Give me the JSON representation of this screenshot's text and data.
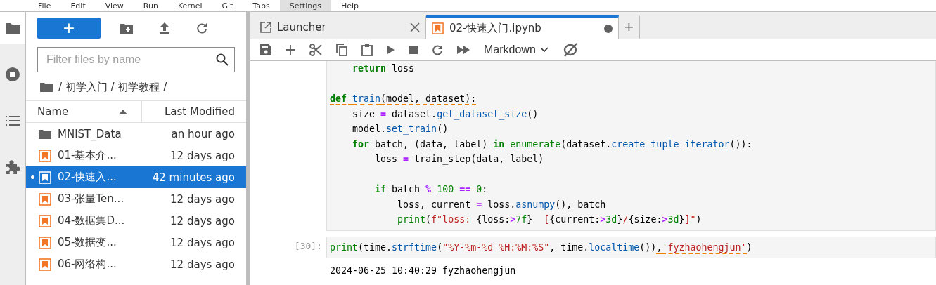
{
  "menu": [
    {
      "label": "File",
      "active": false
    },
    {
      "label": "Edit",
      "active": false
    },
    {
      "label": "View",
      "active": false
    },
    {
      "label": "Run",
      "active": false
    },
    {
      "label": "Kernel",
      "active": false
    },
    {
      "label": "Git",
      "active": false
    },
    {
      "label": "Tabs",
      "active": false
    },
    {
      "label": "Settings",
      "active": true
    },
    {
      "label": "Help",
      "active": false
    }
  ],
  "activity_bar": [
    {
      "kind": "folder",
      "selected": true
    },
    {
      "kind": "running",
      "selected": false
    },
    {
      "kind": "toc",
      "selected": false
    },
    {
      "kind": "extensions",
      "selected": false
    }
  ],
  "file_browser": {
    "new_button": "+",
    "filter": {
      "placeholder": "Filter files by name"
    },
    "breadcrumb": "/ 初学入门 / 初学教程 /",
    "columns": [
      {
        "label": "Name"
      },
      {
        "label": "Last Modified"
      }
    ],
    "files": [
      {
        "name": "MNIST_Data",
        "modified": "an hour ago",
        "kind": "folder",
        "selected": false,
        "running": false
      },
      {
        "name": "01-基本介...",
        "modified": "12 days ago",
        "kind": "notebook",
        "selected": false,
        "running": false
      },
      {
        "name": "02-快速入...",
        "modified": "42 minutes ago",
        "kind": "notebook",
        "selected": true,
        "running": true
      },
      {
        "name": "03-张量Ten...",
        "modified": "12 days ago",
        "kind": "notebook",
        "selected": false,
        "running": false
      },
      {
        "name": "04-数据集D...",
        "modified": "12 days ago",
        "kind": "notebook",
        "selected": false,
        "running": false
      },
      {
        "name": "05-数据变...",
        "modified": "12 days ago",
        "kind": "notebook",
        "selected": false,
        "running": false
      },
      {
        "name": "06-网络构...",
        "modified": "12 days ago",
        "kind": "notebook",
        "selected": false,
        "running": false
      }
    ]
  },
  "tabs": [
    {
      "label": "Launcher",
      "kind": "launcher",
      "selected": false,
      "dirty": false
    },
    {
      "label": "02-快速入门.ipynb",
      "kind": "notebook",
      "selected": true,
      "dirty": true
    }
  ],
  "new_tab": "+",
  "toolbar": {
    "cell_type": "Markdown"
  },
  "cells": [
    {
      "lines": [
        {
          "kind": "code",
          "tokens": [
            {
              "t": "    return",
              "kind": "kw"
            },
            {
              "t": " loss"
            }
          ]
        },
        {
          "kind": "blank"
        },
        {
          "kind": "code",
          "tokens": [
            {
              "t": "def ",
              "kind": "kw",
              "err": true
            },
            {
              "t": "train",
              "kind": "fn",
              "err": true
            },
            {
              "t": "(model, dataset):",
              "err": true
            }
          ]
        },
        {
          "kind": "code",
          "tokens": [
            {
              "t": "    size "
            },
            {
              "t": "=",
              "kind": "op"
            },
            {
              "t": " dataset."
            },
            {
              "t": "get_dataset_size",
              "kind": "fn"
            },
            {
              "t": "()"
            }
          ]
        },
        {
          "kind": "code",
          "tokens": [
            {
              "t": "    model."
            },
            {
              "t": "set_train",
              "kind": "fn"
            },
            {
              "t": "()"
            }
          ]
        },
        {
          "kind": "code",
          "tokens": [
            {
              "t": "    for",
              "kind": "kw"
            },
            {
              "t": " batch, (data, label) "
            },
            {
              "t": "in ",
              "kind": "kw"
            },
            {
              "t": "enumerate",
              "kind": "bi"
            },
            {
              "t": "(dataset."
            },
            {
              "t": "create_tuple_iterator",
              "kind": "fn"
            },
            {
              "t": "()):"
            }
          ]
        },
        {
          "kind": "code",
          "tokens": [
            {
              "t": "        loss "
            },
            {
              "t": "=",
              "kind": "op"
            },
            {
              "t": " train_step(data, label)"
            }
          ]
        },
        {
          "kind": "blank"
        },
        {
          "kind": "code",
          "tokens": [
            {
              "t": "        if",
              "kind": "kw"
            },
            {
              "t": " batch "
            },
            {
              "t": "% ",
              "kind": "op"
            },
            {
              "t": "100 ",
              "kind": "num"
            },
            {
              "t": "== ",
              "kind": "op"
            },
            {
              "t": "0",
              "kind": "num"
            },
            {
              "t": ":"
            }
          ]
        },
        {
          "kind": "code",
          "tokens": [
            {
              "t": "            loss, current "
            },
            {
              "t": "=",
              "kind": "op"
            },
            {
              "t": " loss."
            },
            {
              "t": "asnumpy",
              "kind": "fn"
            },
            {
              "t": "(), batch"
            }
          ]
        },
        {
          "kind": "code",
          "tokens": [
            {
              "t": "            print",
              "kind": "bi"
            },
            {
              "t": "("
            },
            {
              "t": "f\"loss: ",
              "kind": "str"
            },
            {
              "t": "{loss:"
            },
            {
              "t": ">",
              "kind": "op"
            },
            {
              "t": "7f",
              "kind": "num"
            },
            {
              "t": "}"
            },
            {
              "t": "  [",
              "kind": "str"
            },
            {
              "t": "{current:"
            },
            {
              "t": ">",
              "kind": "op"
            },
            {
              "t": "3d",
              "kind": "num"
            },
            {
              "t": "}"
            },
            {
              "t": "/",
              "kind": "str"
            },
            {
              "t": "{size:"
            },
            {
              "t": ">",
              "kind": "op"
            },
            {
              "t": "3d",
              "kind": "num"
            },
            {
              "t": "}"
            },
            {
              "t": "]\"",
              "kind": "str"
            },
            {
              "t": ")"
            }
          ]
        }
      ]
    },
    {
      "prompt": "[30]:",
      "lines": [
        {
          "kind": "code",
          "tokens": [
            {
              "t": "print",
              "kind": "bi"
            },
            {
              "t": "(time."
            },
            {
              "t": "strftime",
              "kind": "fn"
            },
            {
              "t": "("
            },
            {
              "t": "\"%Y-%m-%d %H:%M:%S\"",
              "kind": "str"
            },
            {
              "t": ", time."
            },
            {
              "t": "localtime",
              "kind": "fn"
            },
            {
              "t": "())"
            },
            {
              "t": ",",
              "err": true
            },
            {
              "t": "'fyzhaohengjun'",
              "kind": "str",
              "err": true
            },
            {
              "t": ")"
            }
          ]
        }
      ],
      "output": "2024-06-25 10:40:29 fyzhaohengjun"
    }
  ]
}
